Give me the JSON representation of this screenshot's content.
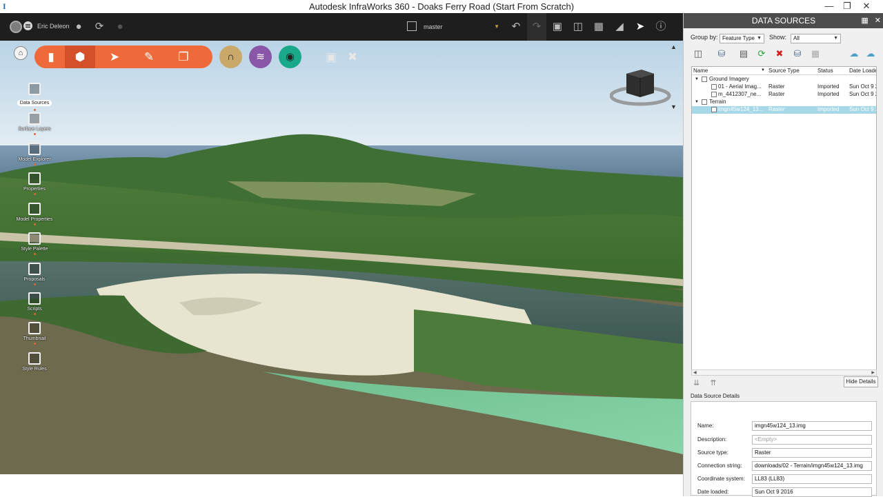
{
  "window": {
    "title": "Autodesk InfraWorks 360 - Doaks Ferry Road (Start From Scratch)",
    "minimize_icon": "minimize-icon",
    "restore_icon": "restore-icon",
    "close_icon": "close-icon"
  },
  "topbar": {
    "user_name": "Eric Deleon",
    "branch": "master"
  },
  "left_rail": {
    "items": [
      {
        "label": "Data Sources",
        "icon": "data-sources-icon"
      },
      {
        "label": "Surface Layers",
        "icon": "surface-layers-icon"
      },
      {
        "label": "Model Explorer",
        "icon": "model-explorer-icon"
      },
      {
        "label": "Properties",
        "icon": "properties-icon"
      },
      {
        "label": "Model Properties",
        "icon": "model-properties-icon"
      },
      {
        "label": "Style Palette",
        "icon": "style-palette-icon"
      },
      {
        "label": "Proposals",
        "icon": "proposals-icon"
      },
      {
        "label": "Scripts",
        "icon": "scripts-icon"
      },
      {
        "label": "Thumbnail",
        "icon": "thumbnail-icon"
      },
      {
        "label": "Style Rules",
        "icon": "style-rules-icon"
      }
    ]
  },
  "panel": {
    "title": "DATA SOURCES",
    "group_by_label": "Group by:",
    "group_by_value": "Feature Type",
    "show_label": "Show:",
    "show_value": "All",
    "columns": [
      "Name",
      "Source Type",
      "Status",
      "Date Loade"
    ],
    "groups": [
      {
        "name": "Ground Imagery",
        "rows": [
          {
            "name": "01 - Aerial Imag...",
            "type": "Raster",
            "status": "Imported",
            "date": "Sun Oct 9 2"
          },
          {
            "name": "m_4412307_ne...",
            "type": "Raster",
            "status": "Imported",
            "date": "Sun Oct 9 2"
          }
        ]
      },
      {
        "name": "Terrain",
        "rows": [
          {
            "name": "imgn45w124_13...",
            "type": "Raster",
            "status": "Imported",
            "date": "Sun Oct 9 2"
          }
        ]
      }
    ],
    "hide_details_label": "Hide Details",
    "details_title": "Data Source Details",
    "details": {
      "name_label": "Name:",
      "name_value": "imgn45w124_13.img",
      "description_label": "Description:",
      "description_value": "<Empty>",
      "source_type_label": "Source type:",
      "source_type_value": "Raster",
      "connection_label": "Connection string:",
      "connection_value": "downloads/02 - Terrain/imgn45w124_13.img",
      "coord_label": "Coordinate system:",
      "coord_value": "LL83 (LL83)",
      "date_label": "Date loaded:",
      "date_value": "Sun Oct 9 2016"
    }
  },
  "colors": {
    "accent_orange": "#ef6a3a",
    "selection_blue": "#a6d8e8",
    "topbar_dark": "#1e1e1e",
    "panel_header": "#4d4d4d"
  }
}
